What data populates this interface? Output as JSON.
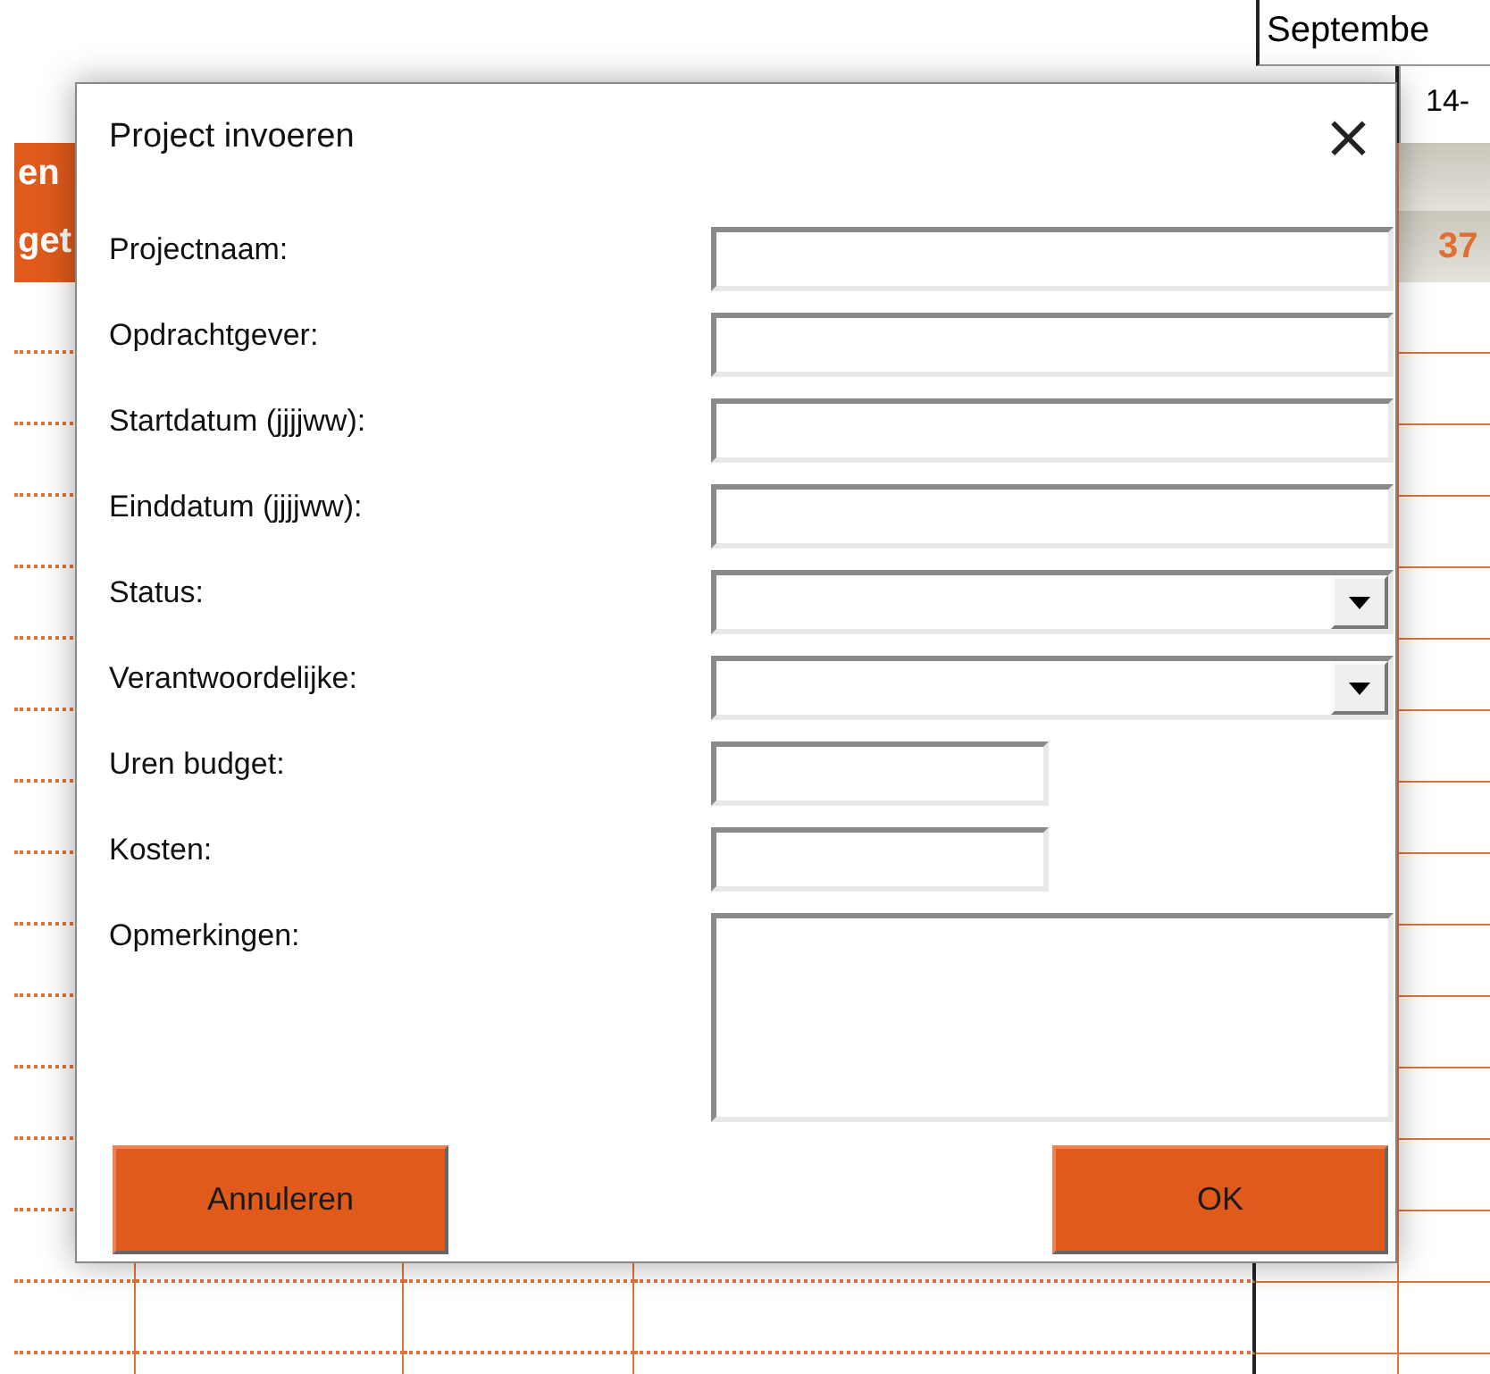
{
  "sheet": {
    "month_header": "Septembe",
    "week_header": "14-",
    "left_header_lines": [
      "en",
      "get"
    ],
    "total": "37"
  },
  "dialog": {
    "title": "Project invoeren",
    "close": "×",
    "fields": [
      {
        "label": "Projectnaam:",
        "kind": "text"
      },
      {
        "label": "Opdrachtgever:",
        "kind": "text"
      },
      {
        "label": "Startdatum (jjjjww):",
        "kind": "text"
      },
      {
        "label": "Einddatum (jjjjww):",
        "kind": "text"
      },
      {
        "label": "Status:",
        "kind": "dropdown"
      },
      {
        "label": "Verantwoordelijke:",
        "kind": "dropdown"
      },
      {
        "label": "Uren budget:",
        "kind": "short"
      },
      {
        "label": "Kosten:",
        "kind": "short"
      },
      {
        "label": "Opmerkingen:",
        "kind": "memo"
      }
    ],
    "buttons": [
      "Annuleren",
      "OK"
    ]
  }
}
